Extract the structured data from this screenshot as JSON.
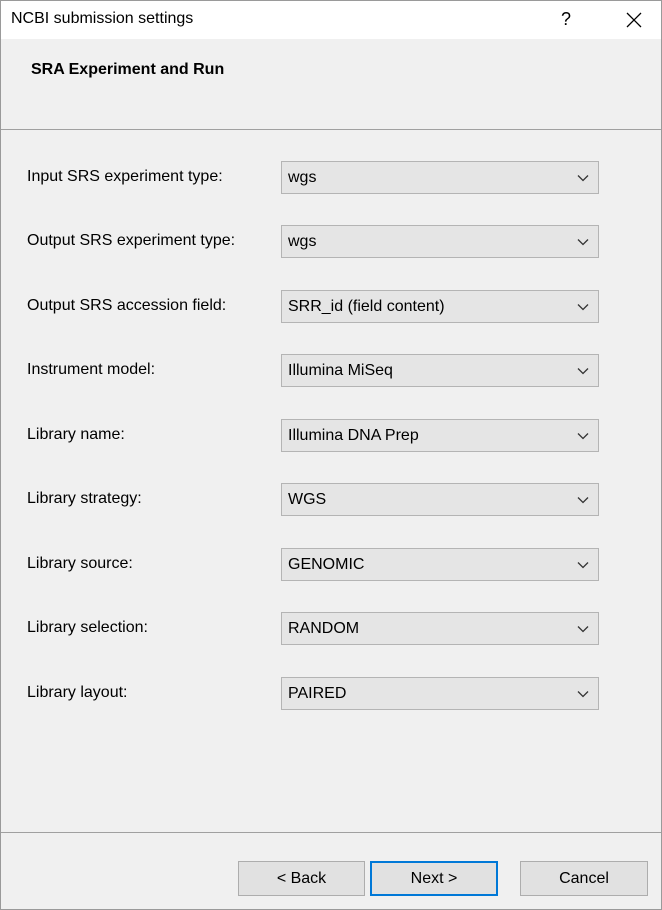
{
  "window": {
    "title": "NCBI submission settings",
    "help_label": "?",
    "close_icon": "close-icon"
  },
  "header": {
    "title": "SRA Experiment and Run"
  },
  "fields": [
    {
      "label": "Input SRS experiment type:",
      "value": "wgs"
    },
    {
      "label": "Output SRS experiment type:",
      "value": "wgs"
    },
    {
      "label": "Output SRS accession field:",
      "value": "SRR_id (field content)"
    },
    {
      "label": "Instrument model:",
      "value": "Illumina MiSeq"
    },
    {
      "label": "Library name:",
      "value": "Illumina DNA Prep"
    },
    {
      "label": "Library strategy:",
      "value": "WGS"
    },
    {
      "label": "Library source:",
      "value": "GENOMIC"
    },
    {
      "label": "Library selection:",
      "value": "RANDOM"
    },
    {
      "label": "Library layout:",
      "value": "PAIRED"
    }
  ],
  "buttons": {
    "back": "< Back",
    "next": "Next >",
    "cancel": "Cancel"
  },
  "colors": {
    "default_button_border": "#0078d7",
    "window_background": "#f0f0f0",
    "combo_background": "#e5e5e5"
  }
}
